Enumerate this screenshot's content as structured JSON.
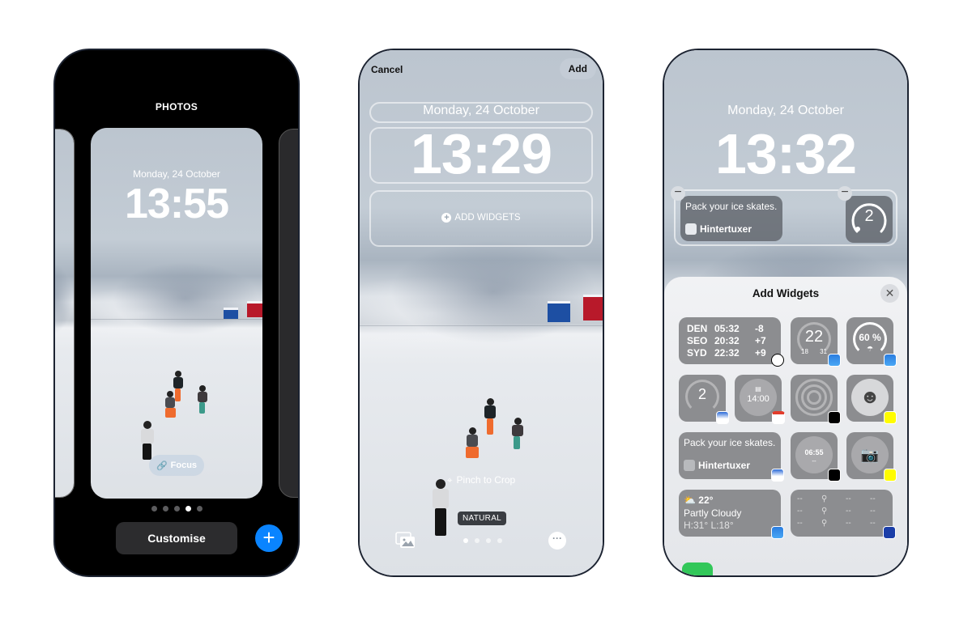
{
  "phone1": {
    "header_title": "PHOTOS",
    "lock_date": "Monday, 24 October",
    "lock_time": "13:55",
    "focus_label": "Focus",
    "page_dots": {
      "count": 5,
      "active_index": 3
    },
    "customise_label": "Customise",
    "add_icon": "plus-icon",
    "colors": {
      "add_button": "#0a84ff",
      "customise_bg": "#2c2c2e"
    }
  },
  "phone2": {
    "cancel_label": "Cancel",
    "add_label": "Add",
    "lock_date": "Monday, 24 October",
    "lock_time": "13:29",
    "add_widgets_label": "ADD WIDGETS",
    "pinch_hint": "Pinch to Crop",
    "filter_label": "NATURAL",
    "page_dots": {
      "count": 4,
      "active_index": 0
    },
    "icons": [
      "crop-icon",
      "photo-library-icon",
      "more-icon"
    ]
  },
  "phone3": {
    "lock_date": "Monday, 24 October",
    "lock_time": "13:32",
    "placed_widgets": [
      {
        "type": "reminder",
        "text": "Pack your ice skates.",
        "app": "Hintertuxer"
      },
      {
        "type": "gauge",
        "value": "2"
      }
    ],
    "sheet": {
      "title": "Add Widgets",
      "close_icon": "close-icon",
      "world_clock": [
        {
          "city": "DEN",
          "time": "05:32",
          "offset": "-8"
        },
        {
          "city": "SEO",
          "time": "20:32",
          "offset": "+7"
        },
        {
          "city": "SYD",
          "time": "22:32",
          "offset": "+9"
        }
      ],
      "temp_gauge": {
        "value": "22",
        "low": "18",
        "high": "31"
      },
      "rain_gauge": {
        "value": "60 %"
      },
      "snow_gauge": {
        "value": "2"
      },
      "calendar": {
        "time": "14:00"
      },
      "reminder": {
        "text": "Pack your ice skates.",
        "app": "Hintertuxer"
      },
      "flight": {
        "time": "06:55",
        "status": "--"
      },
      "weather": {
        "temp": "22°",
        "condition": "Partly Cloudy",
        "range": "H:31° L:18°"
      },
      "twc_placeholder": "--"
    }
  }
}
